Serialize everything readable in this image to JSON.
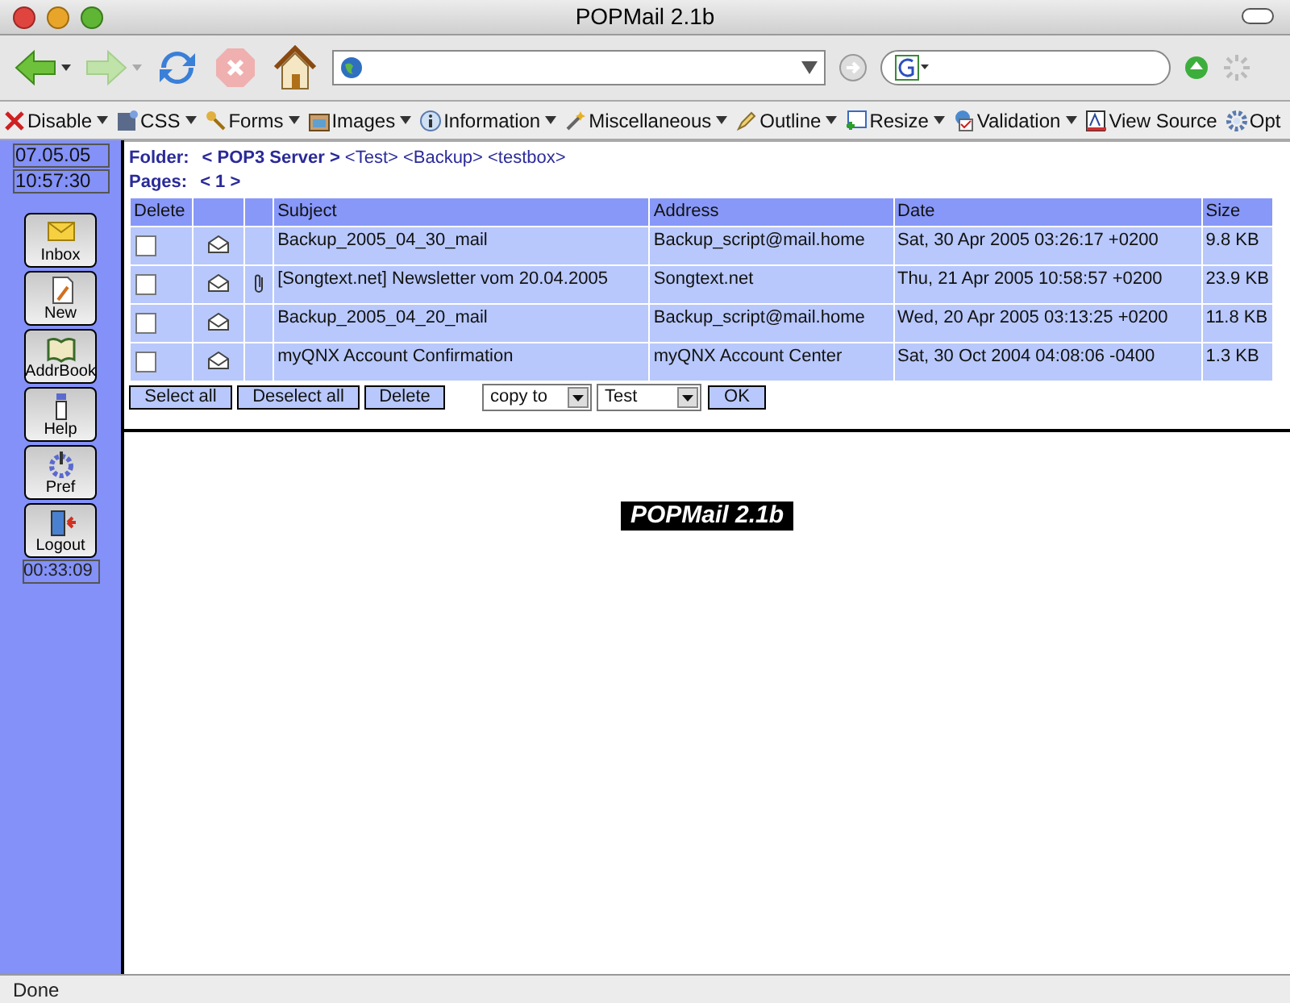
{
  "window": {
    "title": "POPMail 2.1b"
  },
  "dev_toolbar": {
    "items": [
      {
        "label": "Disable",
        "menu": true
      },
      {
        "label": "CSS",
        "menu": true
      },
      {
        "label": "Forms",
        "menu": true
      },
      {
        "label": "Images",
        "menu": true
      },
      {
        "label": "Information",
        "menu": true
      },
      {
        "label": "Miscellaneous",
        "menu": true
      },
      {
        "label": "Outline",
        "menu": true
      },
      {
        "label": "Resize",
        "menu": true
      },
      {
        "label": "Validation",
        "menu": true
      },
      {
        "label": "View Source",
        "menu": false
      },
      {
        "label": "Opt",
        "menu": false
      }
    ]
  },
  "sidebar": {
    "date": "07.05.05",
    "time": "10:57:30",
    "buttons": [
      "Inbox",
      "New",
      "AddrBook",
      "Help",
      "Pref",
      "Logout"
    ],
    "session_timer": "00:33:09"
  },
  "folder": {
    "label": "Folder:",
    "current": "< POP3 Server >",
    "links": [
      "<Test>",
      "<Backup>",
      "<testbox>"
    ]
  },
  "pages": {
    "label": "Pages:",
    "value": "< 1 >"
  },
  "table": {
    "columns": [
      "Delete",
      "",
      "",
      "Subject",
      "Address",
      "Date",
      "Size"
    ],
    "rows": [
      {
        "checked": false,
        "attachment": false,
        "subject": "Backup_2005_04_30_mail",
        "address": "Backup_script@mail.home",
        "date": "Sat, 30 Apr 2005 03:26:17 +0200",
        "size": "9.8 KB"
      },
      {
        "checked": false,
        "attachment": true,
        "subject": "[Songtext.net] Newsletter vom 20.04.2005",
        "address": "Songtext.net",
        "date": "Thu, 21 Apr 2005 10:58:57 +0200",
        "size": "23.9 KB"
      },
      {
        "checked": false,
        "attachment": false,
        "subject": "Backup_2005_04_20_mail",
        "address": "Backup_script@mail.home",
        "date": "Wed, 20 Apr 2005 03:13:25 +0200",
        "size": "11.8 KB"
      },
      {
        "checked": false,
        "attachment": false,
        "subject": "myQNX Account Confirmation",
        "address": "myQNX Account Center",
        "date": "Sat, 30 Oct 2004 04:08:06 -0400",
        "size": "1.3 KB"
      }
    ]
  },
  "actions": {
    "buttons": [
      "Select all",
      "Deselect all",
      "Delete"
    ],
    "copy_select": "copy to",
    "folder_select": "Test",
    "ok": "OK"
  },
  "banner": "POPMail 2.1b",
  "status_bar": "Done"
}
